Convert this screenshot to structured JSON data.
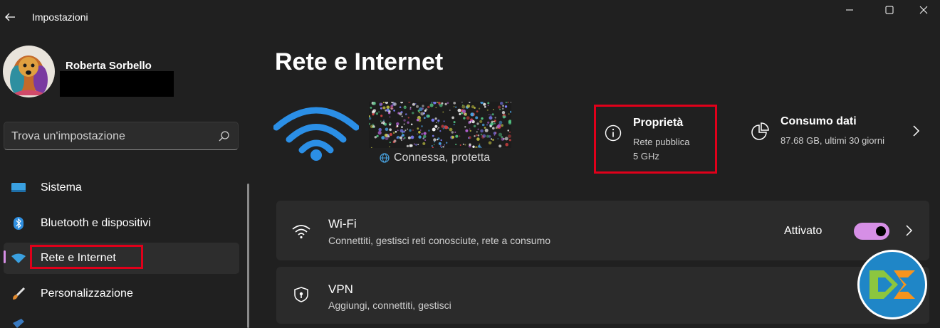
{
  "titlebar": {
    "app_title": "Impostazioni",
    "back_icon": "arrow-left-icon",
    "controls": [
      "minimize-icon",
      "maximize-icon",
      "close-icon"
    ]
  },
  "profile": {
    "name": "Roberta Sorbello"
  },
  "search": {
    "placeholder": "Trova un'impostazione",
    "icon": "search-icon"
  },
  "sidebar": {
    "items": [
      {
        "label": "Sistema",
        "icon": "monitor-icon"
      },
      {
        "label": "Bluetooth e dispositivi",
        "icon": "bluetooth-icon"
      },
      {
        "label": "Rete e Internet",
        "icon": "wifi-icon",
        "selected": true
      },
      {
        "label": "Personalizzazione",
        "icon": "paintbrush-icon"
      }
    ]
  },
  "page": {
    "title": "Rete e Internet"
  },
  "network": {
    "status": "Connessa, protetta",
    "status_icon": "globe-icon"
  },
  "properties": {
    "title": "Proprietà",
    "type": "Rete pubblica",
    "band": "5 GHz",
    "icon": "info-icon"
  },
  "data_usage": {
    "title": "Consumo dati",
    "subtitle": "87.68 GB, ultimi 30 giorni",
    "icon": "pie-chart-icon"
  },
  "cards": [
    {
      "title": "Wi-Fi",
      "subtitle": "Connettiti, gestisci reti conosciute, rete a consumo",
      "toggle_label": "Attivato",
      "toggle_on": true,
      "icon": "wifi-icon"
    },
    {
      "title": "VPN",
      "subtitle": "Aggiungi, connettiti, gestisci",
      "icon": "shield-icon"
    }
  ],
  "colors": {
    "background": "#202020",
    "accent": "#d68fe6",
    "highlight_box": "#e0001a",
    "card": "#2b2b2b"
  }
}
